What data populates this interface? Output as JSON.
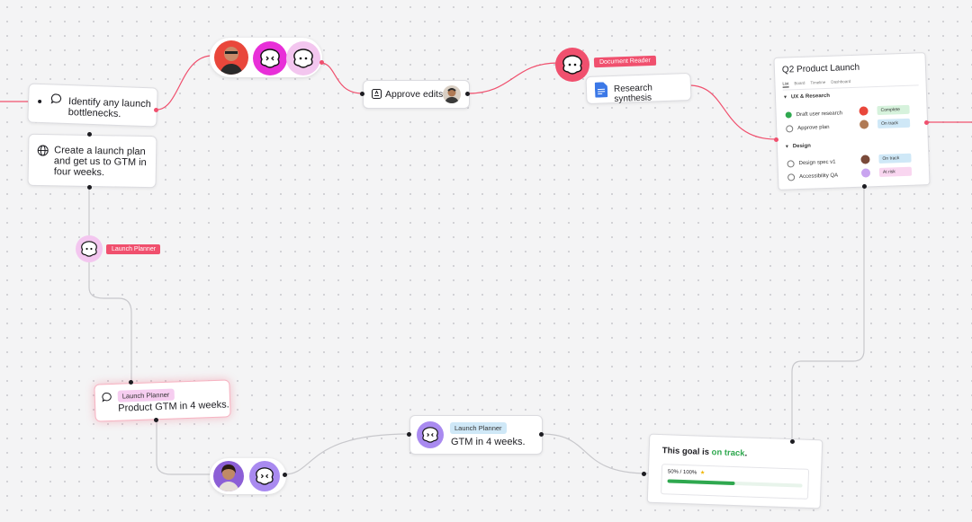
{
  "nodes": {
    "identify": "Identify any launch bottlenecks.",
    "plan": "Create a launch plan and get us to GTM in four weeks.",
    "approve": "Approve edits",
    "research": "Research synthesis",
    "product_gtm": "Product GTM in 4 weeks.",
    "gtm": "GTM in 4 weeks."
  },
  "tags": {
    "document_reader": "Document Reader",
    "launch_planner": "Launch Planner",
    "launch_planner_chip1": "Launch Planner",
    "launch_planner_chip2": "Launch Planner"
  },
  "project": {
    "title": "Q2 Product Launch",
    "tabs": [
      "List",
      "Board",
      "Timeline",
      "Dashboard"
    ],
    "sections": [
      {
        "name": "UX & Research",
        "tasks": [
          {
            "name": "Draft user research",
            "status": "Complete",
            "done": true
          },
          {
            "name": "Approve plan",
            "status": "On track",
            "done": false
          }
        ]
      },
      {
        "name": "Design",
        "tasks": [
          {
            "name": "Design spec v1",
            "status": "On track",
            "done": false
          },
          {
            "name": "Accessibility QA",
            "status": "At risk",
            "done": false
          }
        ]
      }
    ]
  },
  "goal": {
    "prefix": "This goal is",
    "status": "on track",
    "suffix": ".",
    "progress_label": "50% / 100%",
    "progress": 0.5
  },
  "colors": {
    "accent_red": "#f0506e",
    "complete": "#d6f2dc",
    "on_track": "#cfe8f7",
    "at_risk": "#f9d6f0",
    "progress_green": "#2fa84f",
    "goal_green": "#2fa84f"
  }
}
